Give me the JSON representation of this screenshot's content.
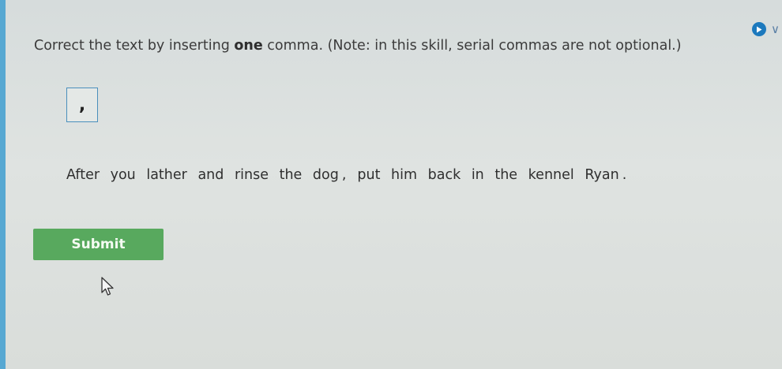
{
  "instruction": {
    "prefix": "Correct the text by inserting ",
    "emphasis": "one",
    "suffix": " comma. (Note: in this skill, serial commas are not optional.)"
  },
  "draggable_tile": {
    "label": ","
  },
  "sentence": {
    "tokens": [
      "After",
      "you",
      "lather",
      "and",
      "rinse",
      "the",
      "dog",
      ",",
      "put",
      "him",
      "back",
      "in",
      "the",
      "kennel",
      "Ryan",
      "."
    ]
  },
  "submit": {
    "label": "Submit"
  },
  "colors": {
    "accent_blue": "#1c79bd",
    "submit_green": "#58a95e",
    "left_strip": "#57a8d2"
  },
  "icons": {
    "top_right": [
      "play-icon",
      "chevron-down-icon"
    ],
    "pointer": "mouse-cursor-icon"
  }
}
